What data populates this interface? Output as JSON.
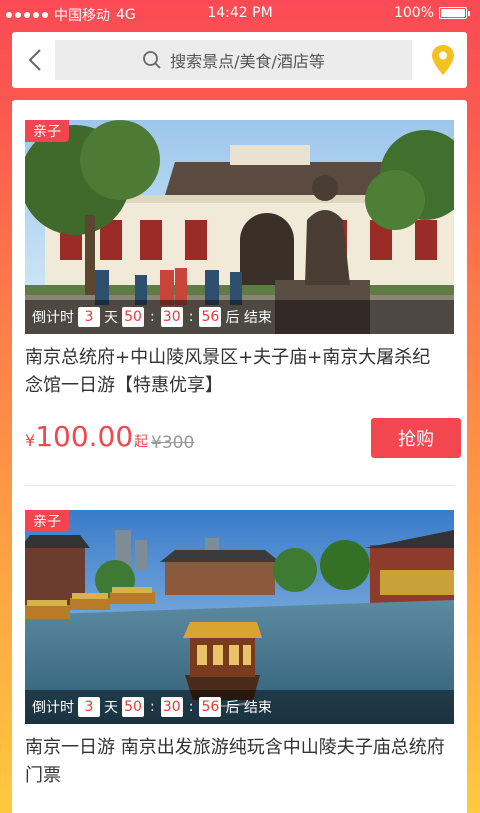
{
  "status_bar": {
    "carrier": "中国移动",
    "network": "4G",
    "time": "14:42 PM",
    "battery": "100%"
  },
  "header": {
    "search_placeholder": "搜索景点/美食/酒店等"
  },
  "deals": [
    {
      "tag": "亲子",
      "countdown": {
        "prefix": "倒计时",
        "days": "3",
        "day_unit": "天",
        "hours": "50",
        "minutes": "30",
        "seconds": "56",
        "suffix": "后 结束"
      },
      "title": "南京总统府+中山陵风景区+夫子庙+南京大屠杀纪念馆一日游【特惠优享】",
      "price": {
        "currency": "¥",
        "amount": "100.00",
        "qi": "起",
        "original": "¥300"
      },
      "buy_label": "抢购"
    },
    {
      "tag": "亲子",
      "countdown": {
        "prefix": "倒计时",
        "days": "3",
        "day_unit": "天",
        "hours": "50",
        "minutes": "30",
        "seconds": "56",
        "suffix": "后 结束"
      },
      "title": "南京一日游 南京出发旅游纯玩含中山陵夫子庙总统府门票"
    }
  ],
  "colors": {
    "accent": "#f2474f",
    "pin": "#f5c122"
  }
}
